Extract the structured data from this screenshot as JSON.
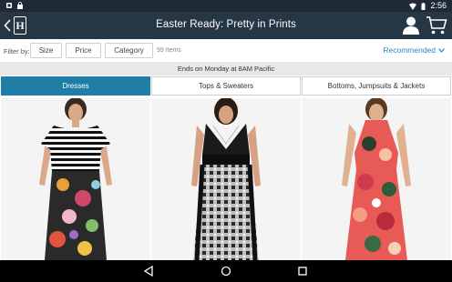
{
  "status_bar": {
    "time": "2:56",
    "left_icons": [
      "notification-icon",
      "shopping-bag-icon"
    ],
    "right_icons": [
      "wifi-icon",
      "battery-icon"
    ]
  },
  "header": {
    "logo_letter": "H",
    "title": "Easter Ready: Pretty in Prints",
    "bg_color": "#253645"
  },
  "filters": {
    "label": "Filter by:",
    "chips": [
      "Size",
      "Price",
      "Category"
    ],
    "item_count": "99 Items",
    "sort": "Recommended"
  },
  "promo": "Ends on Monday at 8AM Pacific",
  "tabs": [
    {
      "label": "Dresses",
      "active": true
    },
    {
      "label": "Tops & Sweaters",
      "active": false
    },
    {
      "label": "Bottoms, Jumpsuits & Jackets",
      "active": false
    }
  ],
  "products": [
    {
      "name": "striped-floral-maxi-dress"
    },
    {
      "name": "black-white-print-maxi-dress"
    },
    {
      "name": "coral-floral-halter-maxi-dress"
    }
  ],
  "colors": {
    "accent": "#1e7ea5",
    "link": "#2a86c2"
  }
}
